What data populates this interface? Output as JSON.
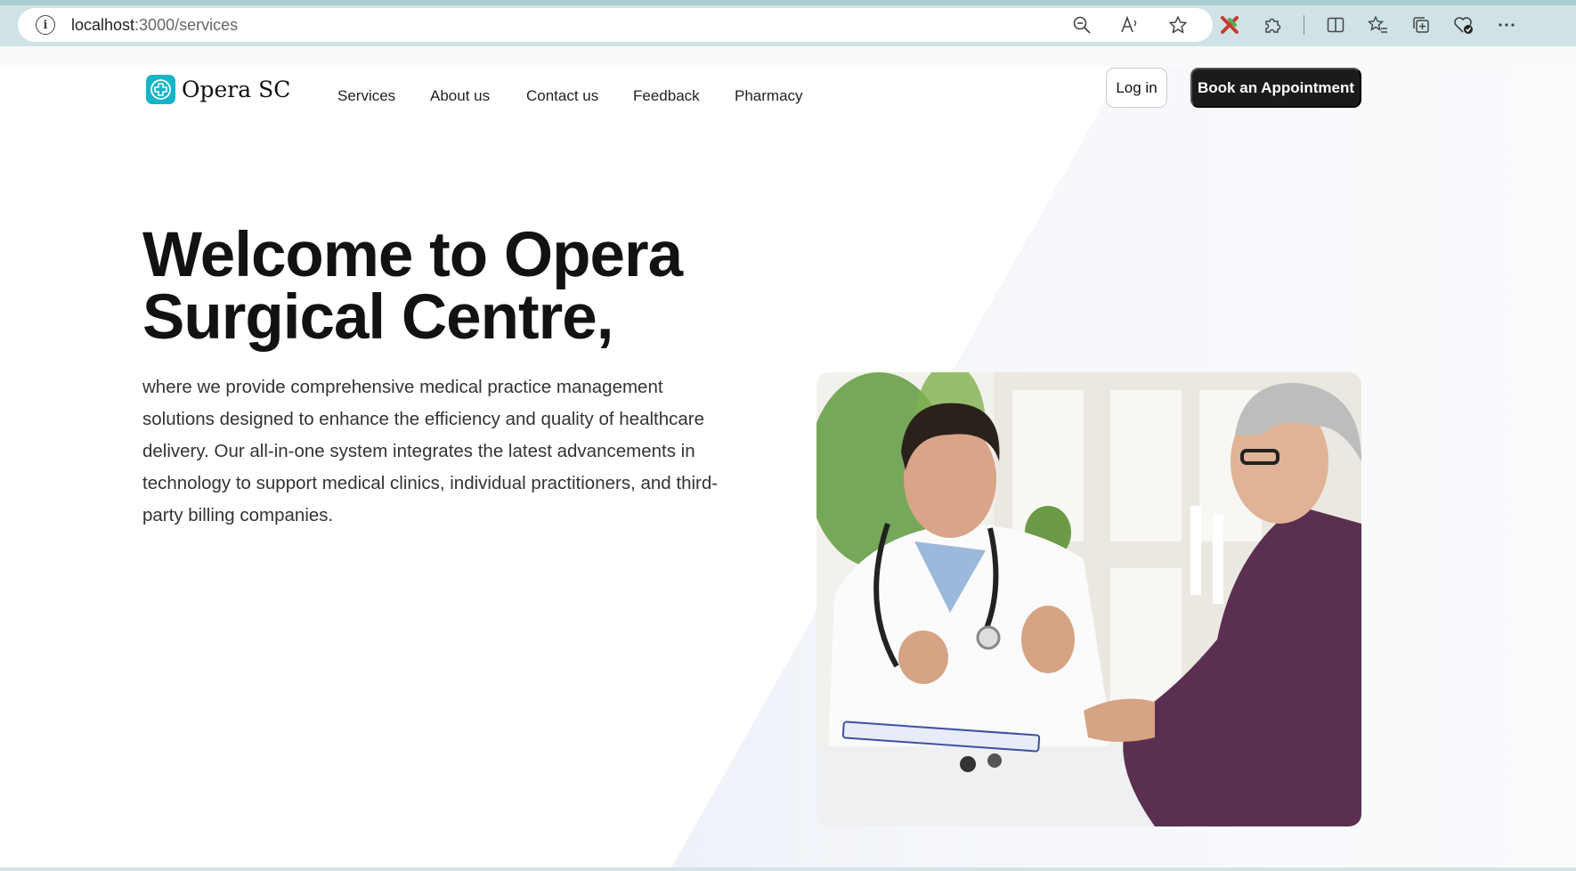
{
  "browser": {
    "url_host": "localhost",
    "url_path": ":3000/services",
    "icons": [
      "info-icon",
      "zoom-out-icon",
      "read-aloud-icon",
      "favorite-star-icon",
      "extension-colored-icon",
      "extensions-puzzle-icon",
      "split-screen-icon",
      "favorites-list-icon",
      "collections-icon",
      "browser-essentials-icon",
      "more-menu-icon"
    ]
  },
  "nav": {
    "brand": "Opera SC",
    "links": [
      "Services",
      "About us",
      "Contact us",
      "Feedback",
      "Pharmacy"
    ],
    "login": "Log in",
    "book": "Book an Appointment"
  },
  "hero": {
    "title": "Welcome to Opera Surgical Centre,",
    "description": "where we provide comprehensive medical practice management solutions designed to enhance the efficiency and quality of healthcare delivery. Our all-in-one system integrates the latest advancements in technology to support medical clinics, individual practitioners, and third-party billing companies.",
    "image_subject": "doctor-consulting-patient-photo"
  },
  "colors": {
    "brand_teal": "#16b4c7",
    "button_dark": "#1b1b1c",
    "browser_chrome": "#cfe3e6"
  }
}
